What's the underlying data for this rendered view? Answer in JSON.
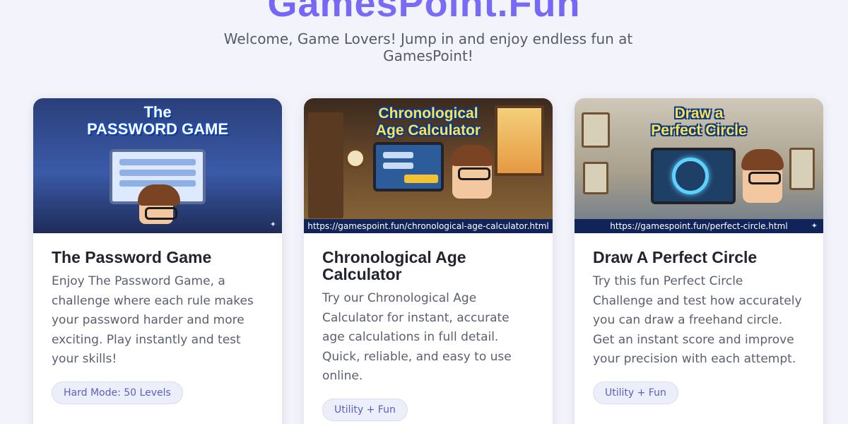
{
  "site": {
    "title": "GamesPoint.Fun",
    "tagline": "Welcome, Game Lovers! Jump in and enjoy endless fun at GamesPoint!"
  },
  "cards": [
    {
      "image_title": "The\nPASSWORD GAME",
      "url": "",
      "title": "The Password Game",
      "description": "Enjoy The Password Game, a challenge where each rule makes your password harder and more exciting. Play instantly and test your skills!",
      "badge": "Hard Mode: 50 Levels"
    },
    {
      "image_title": "Chronological\nAge Calculator",
      "url": "https://gamespoint.fun/chronological-age-calculator.html",
      "title": "Chronological Age Calculator",
      "description": "Try our Chronological Age Calculator for instant, accurate age calculations in full detail. Quick, reliable, and easy to use online.",
      "badge": "Utility + Fun"
    },
    {
      "image_title": "Draw a\nPerfect Circle",
      "url": "https://gamespoint.fun/perfect-circle.html",
      "title": "Draw A Perfect Circle",
      "description": "Try this fun Perfect Circle Challenge and test how accurately you can draw a freehand circle. Get an instant score and improve your precision with each attempt.",
      "badge": "Utility + Fun"
    }
  ],
  "colors": {
    "brand": "#6c5ce7",
    "badge_text": "#5a5fc0",
    "background": "#f3f4fb"
  },
  "icons": {
    "sparkle": "sparkle-icon"
  }
}
